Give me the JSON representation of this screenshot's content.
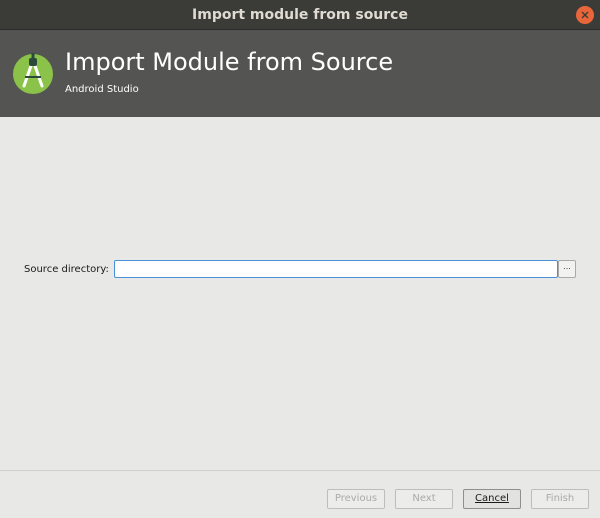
{
  "window": {
    "title": "Import module from source"
  },
  "banner": {
    "heading": "Import Module from Source",
    "subheading": "Android Studio"
  },
  "form": {
    "source_label": "Source directory:",
    "source_value": "",
    "browse_label": "..."
  },
  "footer": {
    "previous_label": "Previous",
    "next_label": "Next",
    "cancel_label": "Cancel",
    "finish_label": "Finish"
  },
  "colors": {
    "logo_green": "#8bc34a",
    "input_focus": "#4a90d9",
    "close": "#e9663b"
  }
}
